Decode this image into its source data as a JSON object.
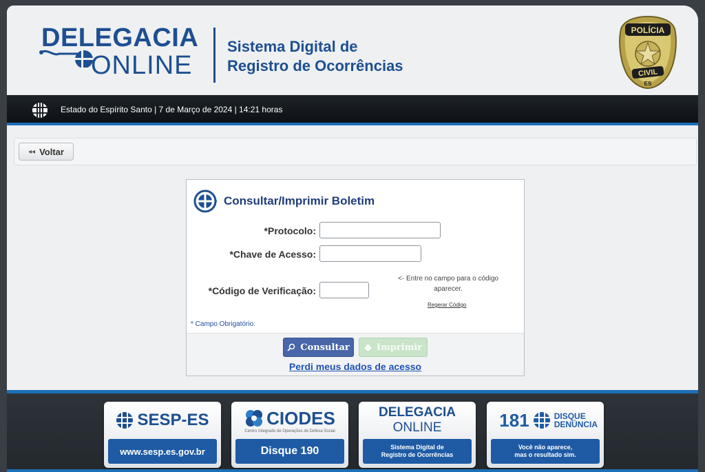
{
  "header": {
    "logo_line1": "DELEGACIA",
    "logo_line2": "ONLINE",
    "system_title_line1": "Sistema Digital de",
    "system_title_line2": "Registro de Ocorrências",
    "badge_top": "POLÍCIA",
    "badge_bottom": "CIVIL",
    "badge_state": "ES"
  },
  "infobar": {
    "text": "Estado do Espírito Santo | 7 de Março de 2024 | 14:21 horas"
  },
  "toolbar": {
    "back_label": "Voltar"
  },
  "form": {
    "title": "Consultar/Imprimir Boletim",
    "protocol_label": "*Protocolo:",
    "protocol_value": "",
    "key_label": "*Chave de Acesso:",
    "key_value": "",
    "code_label": "*Código de Verificação:",
    "code_value": "",
    "hint": "<- Entre no campo para o código aparecer.",
    "regen_label": "Regerar Código",
    "required_note": "* Campo Obrigatório.",
    "consult_label": "Consultar",
    "print_label": "Imprimir",
    "lost_link": "Perdi meus dados de acesso"
  },
  "footer": {
    "cards": [
      {
        "title": "SESP-ES",
        "subtitle": "",
        "bottom": "www.sesp.es.gov.br",
        "bottom2": ""
      },
      {
        "title": "CIODES",
        "subtitle": "Centro Integrado de Operações de Defesa Social",
        "bottom": "Disque 190",
        "bottom2": ""
      },
      {
        "title": "DELEGACIA",
        "subtitle": "ONLINE",
        "bottom": "Sistema Digital de",
        "bottom2": "Registro de Ocorrências"
      },
      {
        "title": "181",
        "subtitle": "DISQUE DENÚNCIA",
        "bottom": "Você não aparece,",
        "bottom2": "mas o resultado sim."
      }
    ]
  },
  "colors": {
    "brand_blue": "#1d4f91",
    "accent_blue": "#1d6fb8",
    "consult_button": "#4866a8",
    "print_button_disabled": "#c9e4c9"
  }
}
